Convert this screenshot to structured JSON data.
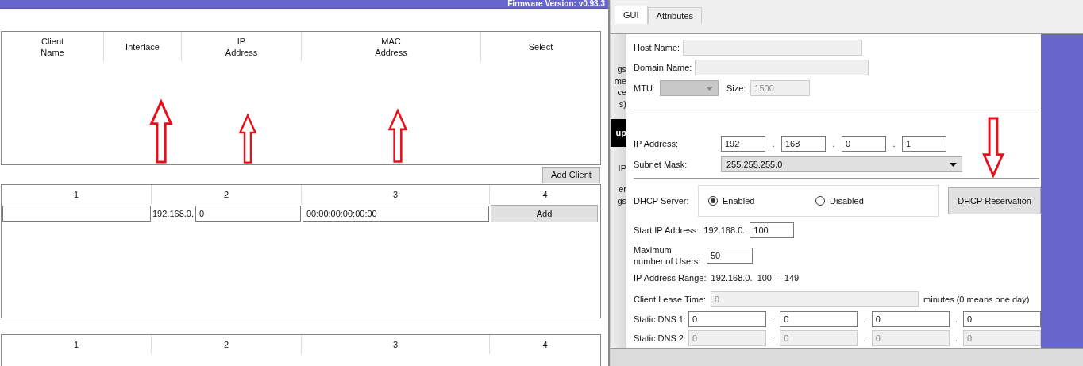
{
  "left_window": {
    "version_text": "Firmware Version: v0.93.3",
    "clients_table": {
      "columns": [
        {
          "lines": [
            "Client",
            "Name"
          ]
        },
        {
          "lines": [
            "Interface"
          ]
        },
        {
          "lines": [
            "IP",
            "Address"
          ]
        },
        {
          "lines": [
            "MAC",
            "Address"
          ]
        },
        {
          "lines": [
            "Select"
          ]
        }
      ]
    },
    "add_client_button": "Add Client",
    "entry_table": {
      "columns": [
        "1",
        "2",
        "3",
        "4"
      ],
      "ip_prefix": "192.168.0.",
      "ip_value": "0",
      "mac_value": "00:00:00:00:00:00",
      "add_button": "Add"
    },
    "lower_table": {
      "columns": [
        "1",
        "2",
        "3",
        "4"
      ]
    }
  },
  "right_window": {
    "tabs": [
      {
        "label": "GUI",
        "selected": true
      },
      {
        "label": "Attributes",
        "selected": false
      }
    ],
    "sidebar_groups": [
      {
        "lines": [
          "gs",
          "me",
          "ce",
          "s)"
        ],
        "selected": false
      },
      {
        "lines": [
          "up"
        ],
        "selected": true
      },
      {
        "lines": [
          "IP"
        ],
        "selected": false
      },
      {
        "lines": [
          "er",
          "gs"
        ],
        "selected": false
      }
    ],
    "host_name": {
      "label": "Host Name:",
      "disabled": true
    },
    "domain_name": {
      "label": "Domain Name:",
      "disabled": true
    },
    "mtu": {
      "label": "MTU:",
      "disabled": true,
      "size_label": "Size:",
      "size_value": "1500"
    },
    "ip_address": {
      "label": "IP Address:",
      "octets": [
        "192",
        "168",
        "0",
        "1"
      ],
      "separator": "."
    },
    "subnet_mask": {
      "label": "Subnet Mask:",
      "value": "255.255.255.0"
    },
    "dhcp_server": {
      "label": "DHCP Server:",
      "options": [
        {
          "label": "Enabled",
          "selected": true
        },
        {
          "label": "Disabled",
          "selected": false
        }
      ],
      "reservation_button": "DHCP Reservation"
    },
    "start_ip": {
      "label": "Start IP Address:",
      "prefix": "192.168.0.",
      "value": "100"
    },
    "max_users": {
      "label": "Maximum number of Users:",
      "value": "50"
    },
    "ip_range": {
      "label": "IP Address Range:",
      "value": "192.168.0.  100  -  149"
    },
    "lease_time": {
      "label": "Client Lease Time:",
      "value": "0",
      "disabled": true,
      "suffix": "minutes (0 means one day)"
    },
    "dns": [
      {
        "label": "Static DNS 1:",
        "octets": [
          "0",
          "0",
          "0",
          "0"
        ],
        "separator": ".",
        "disabled": false
      },
      {
        "label": "Static DNS 2:",
        "octets": [
          "0",
          "0",
          "0",
          "0"
        ],
        "separator": ".",
        "disabled": true
      }
    ]
  }
}
